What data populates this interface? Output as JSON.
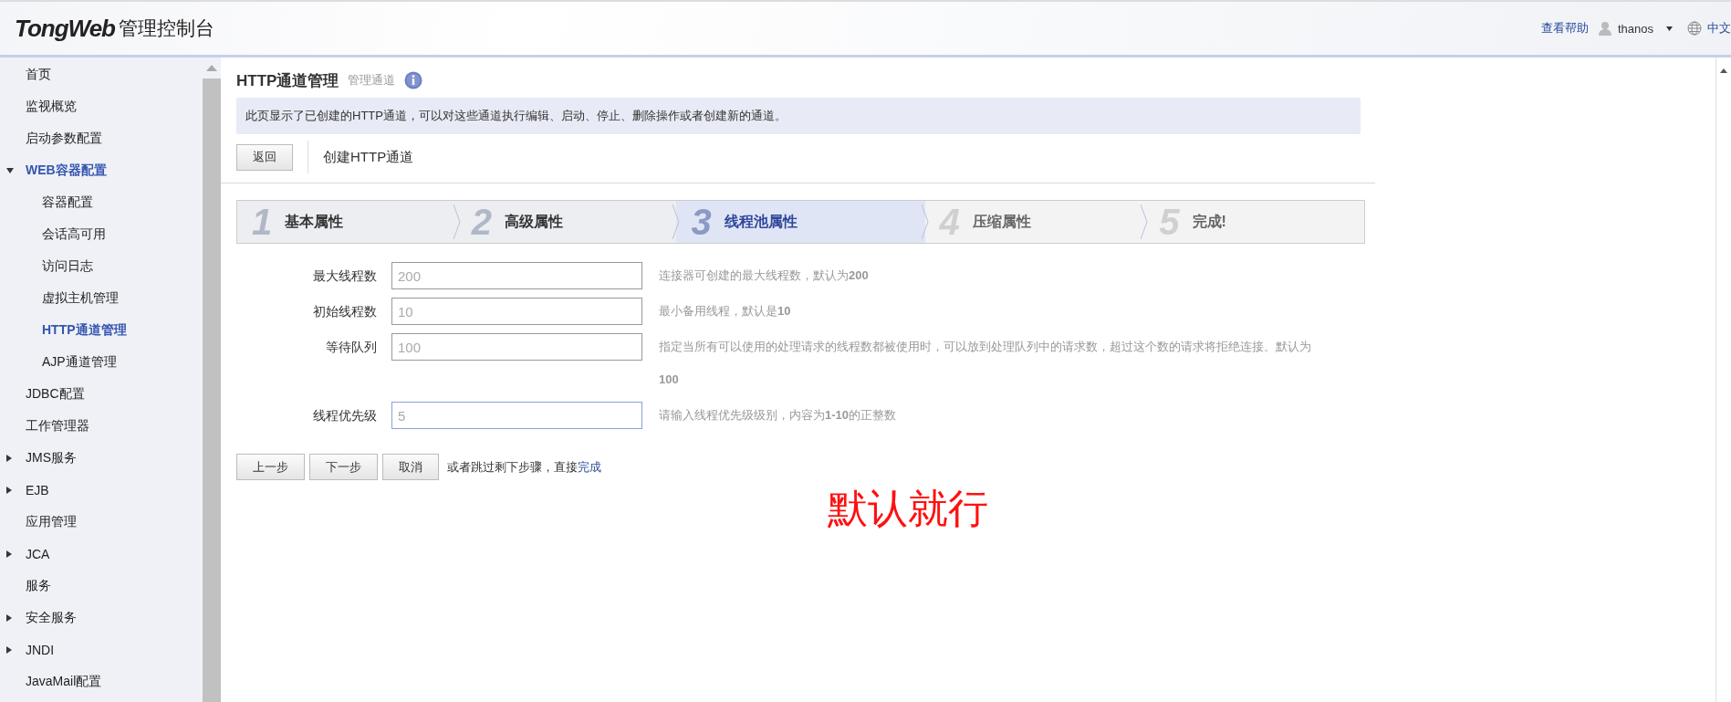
{
  "header": {
    "logo": "TongWeb",
    "title": "管理控制台",
    "help_link": "查看帮助",
    "user": "thanos",
    "language": "中文"
  },
  "sidebar": {
    "items": [
      {
        "label": "首页",
        "selected": false
      },
      {
        "label": "监视概览",
        "selected": false
      },
      {
        "label": "启动参数配置",
        "selected": false
      },
      {
        "label": "WEB容器配置",
        "selected": true,
        "expanded": true,
        "children": [
          {
            "label": "容器配置",
            "selected": false
          },
          {
            "label": "会话高可用",
            "selected": false
          },
          {
            "label": "访问日志",
            "selected": false
          },
          {
            "label": "虚拟主机管理",
            "selected": false
          },
          {
            "label": "HTTP通道管理",
            "selected": true
          },
          {
            "label": "AJP通道管理",
            "selected": false
          }
        ]
      },
      {
        "label": "JDBC配置",
        "selected": false
      },
      {
        "label": "工作管理器",
        "selected": false
      },
      {
        "label": "JMS服务",
        "selected": false,
        "expanded": false
      },
      {
        "label": "EJB",
        "selected": false,
        "expanded": false
      },
      {
        "label": "应用管理",
        "selected": false
      },
      {
        "label": "JCA",
        "selected": false,
        "expanded": false
      },
      {
        "label": "服务",
        "selected": false
      },
      {
        "label": "安全服务",
        "selected": false,
        "expanded": false
      },
      {
        "label": "JNDI",
        "selected": false,
        "expanded": false
      },
      {
        "label": "JavaMail配置",
        "selected": false
      }
    ]
  },
  "page": {
    "title": "HTTP通道管理",
    "subtitle": "管理通道",
    "description": "此页显示了已创建的HTTP通道，可以对这些通道执行编辑、启动、停止、删除操作或者创建新的通道。",
    "back_button": "返回",
    "section_title": "创建HTTP通道"
  },
  "steps": [
    {
      "number": "1",
      "label": "基本属性",
      "completed": true,
      "selected": false
    },
    {
      "number": "2",
      "label": "高级属性",
      "completed": true,
      "selected": false
    },
    {
      "number": "3",
      "label": "线程池属性",
      "completed": false,
      "selected": true
    },
    {
      "number": "4",
      "label": "压缩属性",
      "completed": false,
      "selected": false
    },
    {
      "number": "5",
      "label": "完成!",
      "completed": false,
      "selected": false
    }
  ],
  "fields": [
    {
      "label": "最大线程数",
      "value": "200",
      "focused": false,
      "hint": "连接器可创建的最大线程数，默认为**200**"
    },
    {
      "label": "初始线程数",
      "value": "10",
      "focused": false,
      "hint": "最小备用线程，默认是**10**"
    },
    {
      "label": "等待队列",
      "value": "100",
      "focused": false,
      "hint": "指定当所有可以使用的处理请求的线程数都被使用时，可以放到处理队列中的请求数，超过这个数的请求将拒绝连接。默认为**100**"
    },
    {
      "label": "线程优先级",
      "value": "5",
      "focused": true,
      "hint": "请输入线程优先级级别，内容为**1-10**的正整数"
    }
  ],
  "actions": {
    "buttons": [
      "上一步",
      "下一步",
      "取消"
    ],
    "skip_text": "或者跳过剩下步骤，直接",
    "finish_link": "完成"
  },
  "annotation": "默认就行"
}
